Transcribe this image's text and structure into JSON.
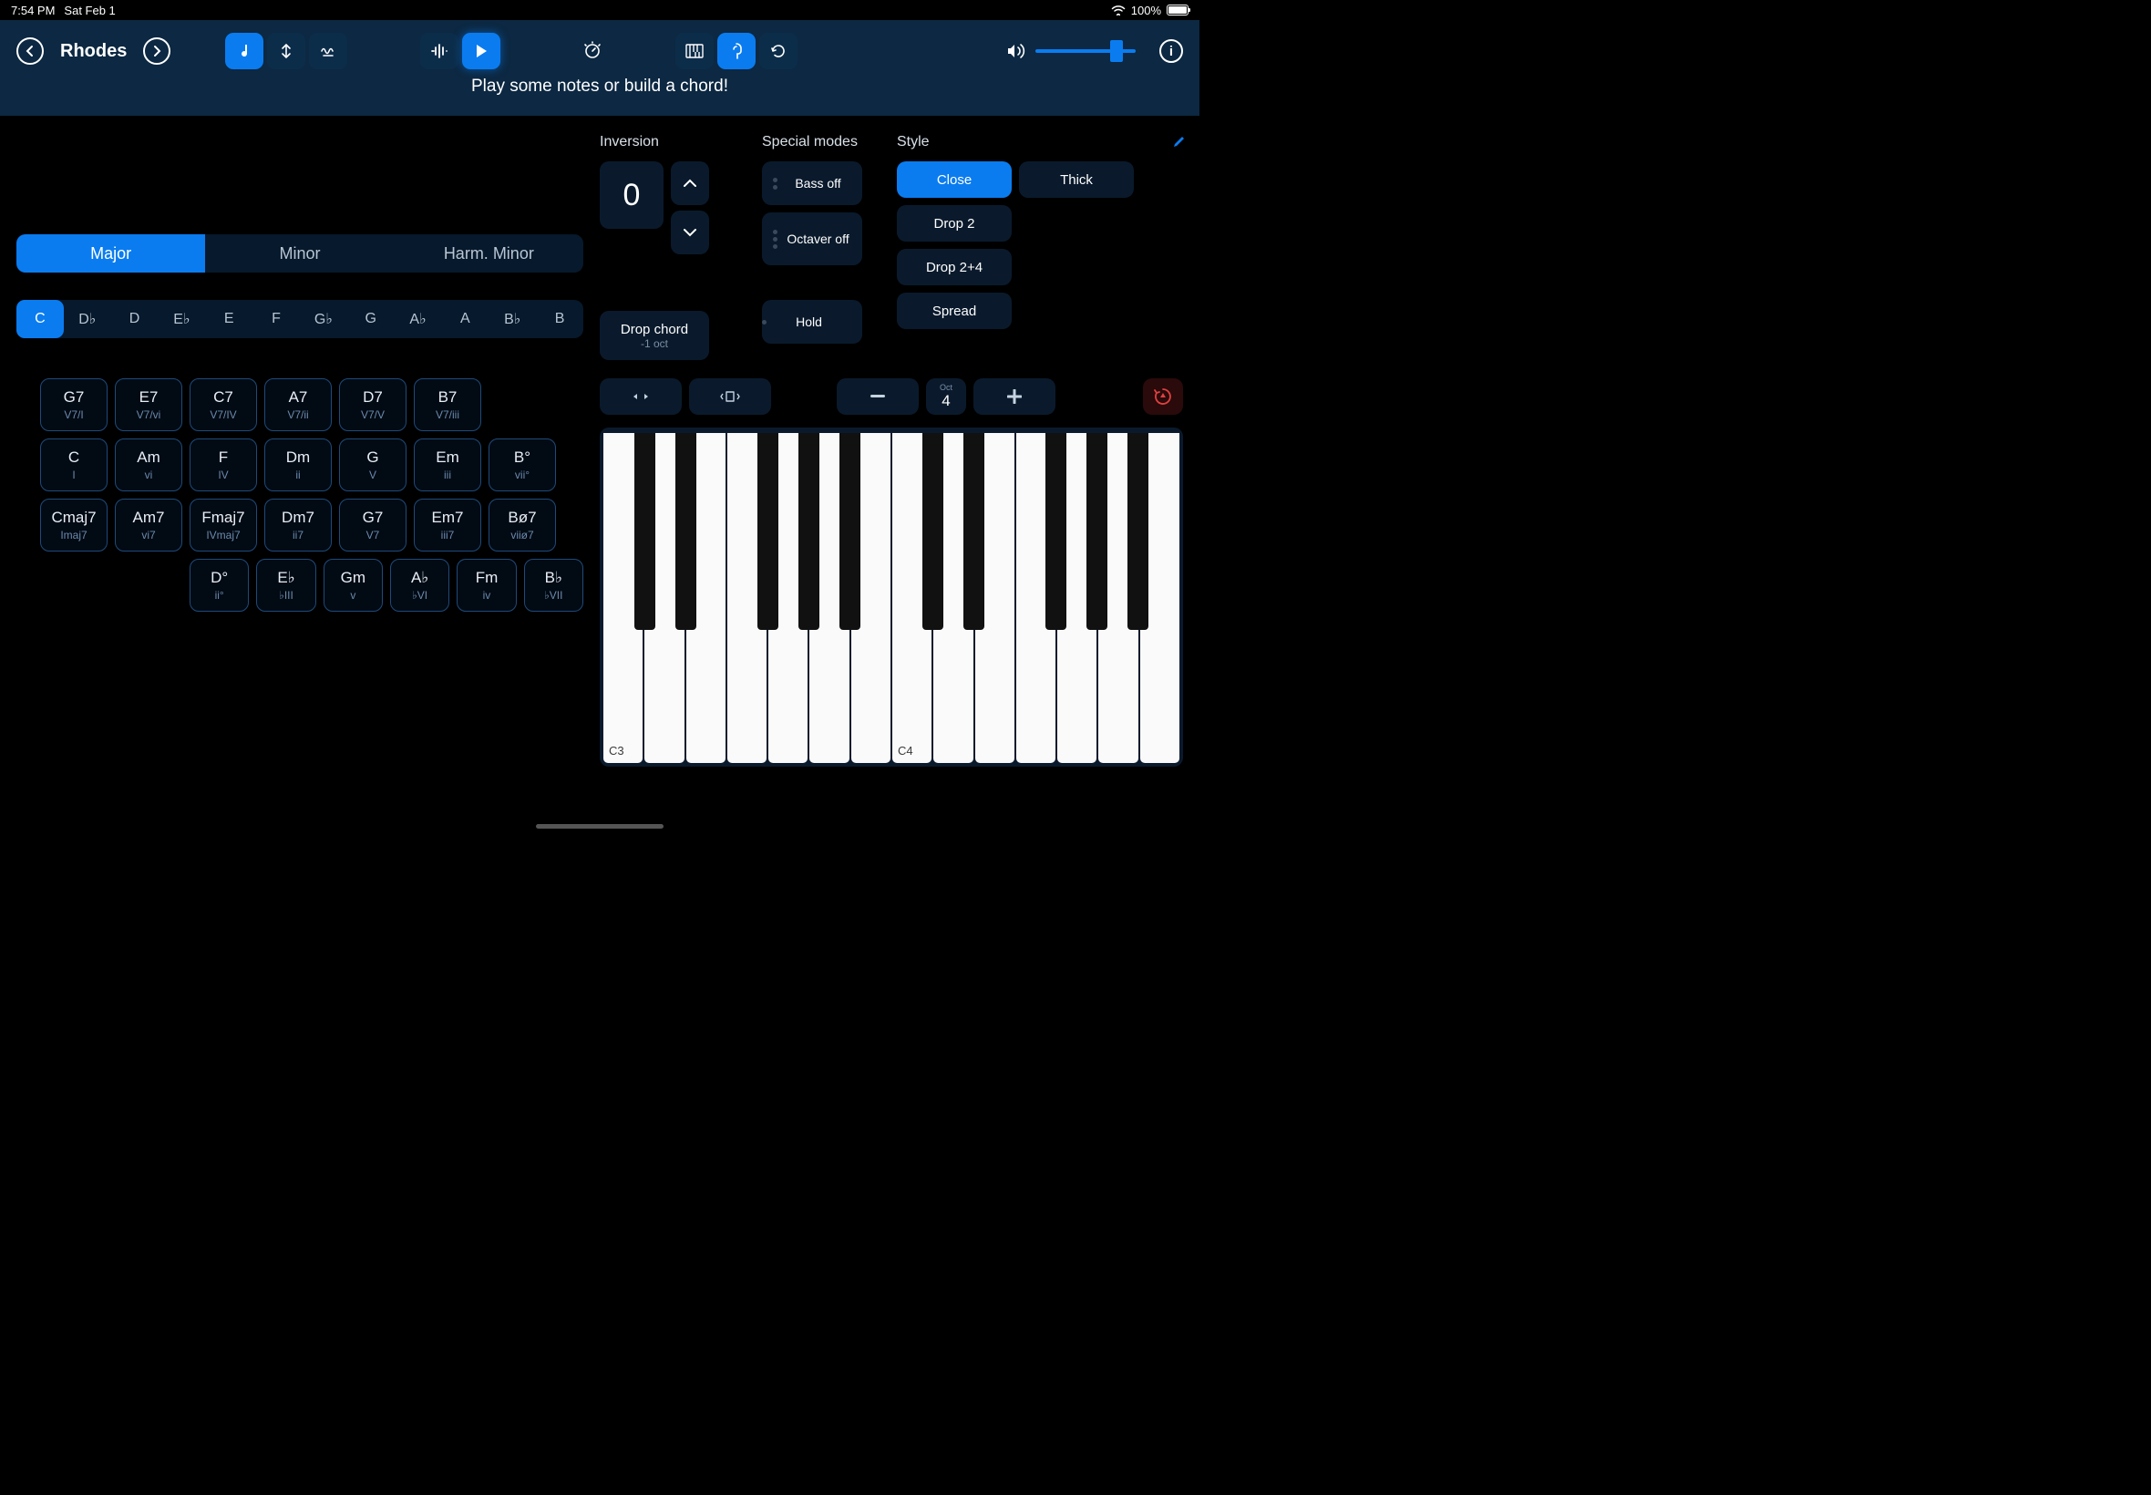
{
  "status": {
    "time": "7:54 PM",
    "date": "Sat Feb 1",
    "battery": "100%"
  },
  "header": {
    "instrument": "Rhodes",
    "hint": "Play some notes or build a chord!"
  },
  "scale_tabs": [
    "Major",
    "Minor",
    "Harm. Minor"
  ],
  "scale_active": 0,
  "root_notes": [
    "C",
    "D♭",
    "D",
    "E♭",
    "E",
    "F",
    "G♭",
    "G",
    "A♭",
    "A",
    "B♭",
    "B"
  ],
  "root_active": 0,
  "chord_rows": [
    [
      {
        "m": "G7",
        "s": "V7/I"
      },
      {
        "m": "E7",
        "s": "V7/vi"
      },
      {
        "m": "C7",
        "s": "V7/IV"
      },
      {
        "m": "A7",
        "s": "V7/ii"
      },
      {
        "m": "D7",
        "s": "V7/V"
      },
      {
        "m": "B7",
        "s": "V7/iii"
      }
    ],
    [
      {
        "m": "C",
        "s": "I"
      },
      {
        "m": "Am",
        "s": "vi"
      },
      {
        "m": "F",
        "s": "IV"
      },
      {
        "m": "Dm",
        "s": "ii"
      },
      {
        "m": "G",
        "s": "V"
      },
      {
        "m": "Em",
        "s": "iii"
      },
      {
        "m": "B°",
        "s": "vii°"
      }
    ],
    [
      {
        "m": "Cmaj7",
        "s": "Imaj7"
      },
      {
        "m": "Am7",
        "s": "vi7"
      },
      {
        "m": "Fmaj7",
        "s": "IVmaj7"
      },
      {
        "m": "Dm7",
        "s": "ii7"
      },
      {
        "m": "G7",
        "s": "V7"
      },
      {
        "m": "Em7",
        "s": "iii7"
      },
      {
        "m": "Bø7",
        "s": "viiø7"
      }
    ],
    [
      {
        "m": "D°",
        "s": "ii°"
      },
      {
        "m": "E♭",
        "s": "♭III"
      },
      {
        "m": "Gm",
        "s": "v"
      },
      {
        "m": "A♭",
        "s": "♭VI"
      },
      {
        "m": "Fm",
        "s": "iv"
      },
      {
        "m": "B♭",
        "s": "♭VII"
      }
    ]
  ],
  "inversion": {
    "label": "Inversion",
    "value": "0",
    "drop_main": "Drop chord",
    "drop_sub": "-1 oct"
  },
  "special_modes": {
    "label": "Special modes",
    "bass": "Bass off",
    "octaver": "Octaver off",
    "hold": "Hold"
  },
  "style": {
    "label": "Style",
    "left": [
      "Close",
      "Drop 2",
      "Drop 2+4",
      "Spread"
    ],
    "right": [
      "Thick"
    ],
    "active": "Close"
  },
  "octave": {
    "label": "Oct",
    "value": "4"
  },
  "piano": {
    "labels": {
      "0": "C3",
      "7": "C4"
    }
  }
}
